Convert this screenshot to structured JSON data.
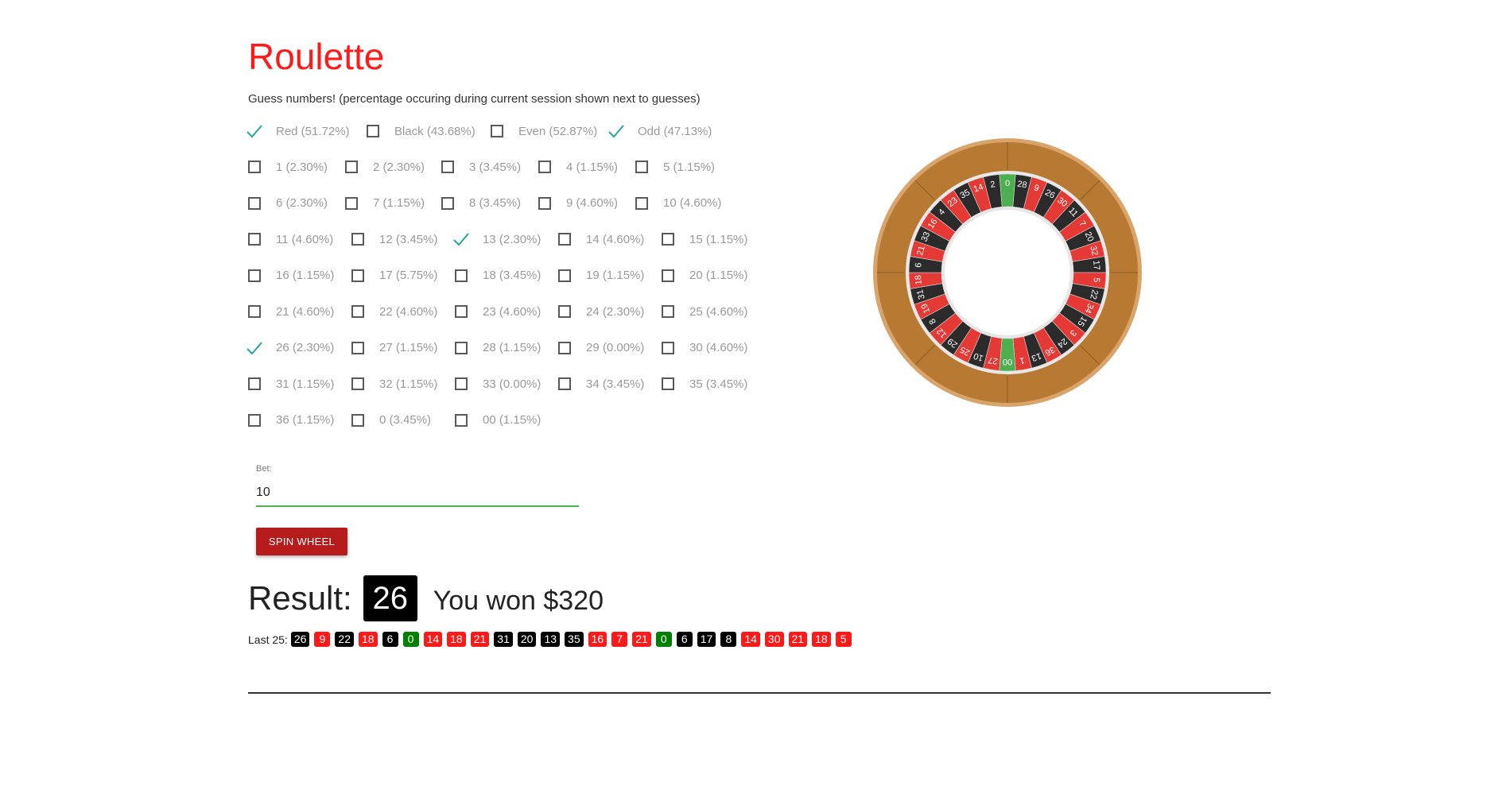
{
  "app": {
    "title": "Roulette",
    "subtitle": "Guess numbers! (percentage occuring during current session shown next to guesses)"
  },
  "guesses": {
    "rows": [
      [
        {
          "label": "Red (51.72%)",
          "checked": true
        },
        {
          "label": "Black (43.68%)",
          "checked": false
        },
        {
          "label": "Even (52.87%)",
          "checked": false
        },
        {
          "label": "Odd (47.13%)",
          "checked": true
        }
      ],
      [
        {
          "label": "1 (2.30%)",
          "checked": false
        },
        {
          "label": "2 (2.30%)",
          "checked": false
        },
        {
          "label": "3 (3.45%)",
          "checked": false
        },
        {
          "label": "4 (1.15%)",
          "checked": false
        },
        {
          "label": "5 (1.15%)",
          "checked": false
        }
      ],
      [
        {
          "label": "6 (2.30%)",
          "checked": false
        },
        {
          "label": "7 (1.15%)",
          "checked": false
        },
        {
          "label": "8 (3.45%)",
          "checked": false
        },
        {
          "label": "9 (4.60%)",
          "checked": false
        },
        {
          "label": "10 (4.60%)",
          "checked": false
        }
      ],
      [
        {
          "label": "11 (4.60%)",
          "checked": false
        },
        {
          "label": "12 (3.45%)",
          "checked": false
        },
        {
          "label": "13 (2.30%)",
          "checked": true
        },
        {
          "label": "14 (4.60%)",
          "checked": false
        },
        {
          "label": "15 (1.15%)",
          "checked": false
        }
      ],
      [
        {
          "label": "16 (1.15%)",
          "checked": false
        },
        {
          "label": "17 (5.75%)",
          "checked": false
        },
        {
          "label": "18 (3.45%)",
          "checked": false
        },
        {
          "label": "19 (1.15%)",
          "checked": false
        },
        {
          "label": "20 (1.15%)",
          "checked": false
        }
      ],
      [
        {
          "label": "21 (4.60%)",
          "checked": false
        },
        {
          "label": "22 (4.60%)",
          "checked": false
        },
        {
          "label": "23 (4.60%)",
          "checked": false
        },
        {
          "label": "24 (2.30%)",
          "checked": false
        },
        {
          "label": "25 (4.60%)",
          "checked": false
        }
      ],
      [
        {
          "label": "26 (2.30%)",
          "checked": true
        },
        {
          "label": "27 (1.15%)",
          "checked": false
        },
        {
          "label": "28 (1.15%)",
          "checked": false
        },
        {
          "label": "29 (0.00%)",
          "checked": false
        },
        {
          "label": "30 (4.60%)",
          "checked": false
        }
      ],
      [
        {
          "label": "31 (1.15%)",
          "checked": false
        },
        {
          "label": "32 (1.15%)",
          "checked": false
        },
        {
          "label": "33 (0.00%)",
          "checked": false
        },
        {
          "label": "34 (3.45%)",
          "checked": false
        },
        {
          "label": "35 (3.45%)",
          "checked": false
        }
      ],
      [
        {
          "label": "36 (1.15%)",
          "checked": false
        },
        {
          "label": "0 (3.45%)",
          "checked": false
        },
        {
          "label": "00 (1.15%)",
          "checked": false
        }
      ]
    ]
  },
  "bet": {
    "label": "Bet:",
    "value": "10"
  },
  "spin_button": {
    "label": "SPIN WHEEL"
  },
  "result": {
    "label": "Result:",
    "number": "26",
    "message": "You won $320"
  },
  "last": {
    "label": "Last 25:",
    "items": [
      {
        "n": "26",
        "color": "black"
      },
      {
        "n": "9",
        "color": "red"
      },
      {
        "n": "22",
        "color": "black"
      },
      {
        "n": "18",
        "color": "red"
      },
      {
        "n": "6",
        "color": "black"
      },
      {
        "n": "0",
        "color": "green"
      },
      {
        "n": "14",
        "color": "red"
      },
      {
        "n": "18",
        "color": "red"
      },
      {
        "n": "21",
        "color": "red"
      },
      {
        "n": "31",
        "color": "black"
      },
      {
        "n": "20",
        "color": "black"
      },
      {
        "n": "13",
        "color": "black"
      },
      {
        "n": "35",
        "color": "black"
      },
      {
        "n": "16",
        "color": "red"
      },
      {
        "n": "7",
        "color": "red"
      },
      {
        "n": "21",
        "color": "red"
      },
      {
        "n": "0",
        "color": "green"
      },
      {
        "n": "6",
        "color": "black"
      },
      {
        "n": "17",
        "color": "black"
      },
      {
        "n": "8",
        "color": "black"
      },
      {
        "n": "14",
        "color": "red"
      },
      {
        "n": "30",
        "color": "red"
      },
      {
        "n": "21",
        "color": "red"
      },
      {
        "n": "18",
        "color": "red"
      },
      {
        "n": "5",
        "color": "red"
      }
    ]
  },
  "wheel": {
    "pockets": [
      {
        "n": "0",
        "c": "green"
      },
      {
        "n": "28",
        "c": "black"
      },
      {
        "n": "9",
        "c": "red"
      },
      {
        "n": "26",
        "c": "black"
      },
      {
        "n": "30",
        "c": "red"
      },
      {
        "n": "11",
        "c": "black"
      },
      {
        "n": "7",
        "c": "red"
      },
      {
        "n": "20",
        "c": "black"
      },
      {
        "n": "32",
        "c": "red"
      },
      {
        "n": "17",
        "c": "black"
      },
      {
        "n": "5",
        "c": "red"
      },
      {
        "n": "22",
        "c": "black"
      },
      {
        "n": "34",
        "c": "red"
      },
      {
        "n": "15",
        "c": "black"
      },
      {
        "n": "3",
        "c": "red"
      },
      {
        "n": "24",
        "c": "black"
      },
      {
        "n": "36",
        "c": "red"
      },
      {
        "n": "13",
        "c": "black"
      },
      {
        "n": "1",
        "c": "red"
      },
      {
        "n": "00",
        "c": "green"
      },
      {
        "n": "27",
        "c": "red"
      },
      {
        "n": "10",
        "c": "black"
      },
      {
        "n": "25",
        "c": "red"
      },
      {
        "n": "29",
        "c": "black"
      },
      {
        "n": "12",
        "c": "red"
      },
      {
        "n": "8",
        "c": "black"
      },
      {
        "n": "19",
        "c": "red"
      },
      {
        "n": "31",
        "c": "black"
      },
      {
        "n": "18",
        "c": "red"
      },
      {
        "n": "6",
        "c": "black"
      },
      {
        "n": "21",
        "c": "red"
      },
      {
        "n": "33",
        "c": "black"
      },
      {
        "n": "16",
        "c": "red"
      },
      {
        "n": "4",
        "c": "black"
      },
      {
        "n": "23",
        "c": "red"
      },
      {
        "n": "35",
        "c": "black"
      },
      {
        "n": "14",
        "c": "red"
      },
      {
        "n": "2",
        "c": "black"
      }
    ]
  },
  "colors": {
    "title": "#ff1a1a",
    "red": "#ff1a1a",
    "black": "#000000",
    "green": "#008000",
    "wheel_red": "#e53935",
    "wheel_black": "#2b2b2b",
    "wheel_green": "#4caf50",
    "wood": "#b87a32",
    "check": "#26a69a",
    "button": "#b71c1c",
    "input_underline": "#4caf50"
  }
}
